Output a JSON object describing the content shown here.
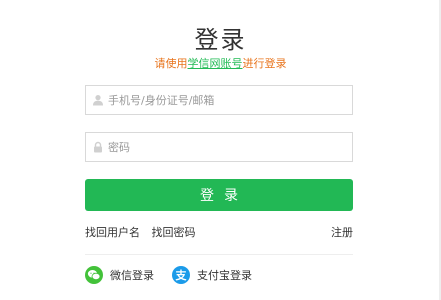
{
  "login": {
    "title": "登录",
    "subtitle_prefix": "请使用",
    "subtitle_link": "学信网账号",
    "subtitle_suffix": "进行登录",
    "username": {
      "value": "",
      "placeholder": "手机号/身份证号/邮箱"
    },
    "password": {
      "value": "",
      "placeholder": "密码"
    },
    "submit_label": "登录",
    "find_username": "找回用户名",
    "find_password": "找回密码",
    "register": "注册",
    "wechat_login": "微信登录",
    "alipay_login": "支付宝登录",
    "alipay_glyph": "支"
  },
  "colors": {
    "primary": "#22b855",
    "accent_text": "#e8741c",
    "link": "#22bb55",
    "wechat": "#43c23a",
    "alipay": "#1b9be9"
  }
}
